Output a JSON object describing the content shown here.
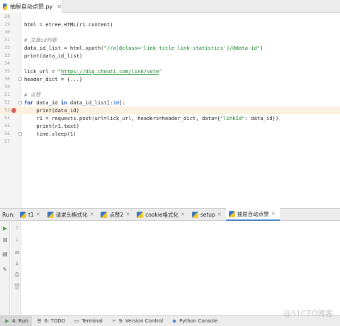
{
  "editor": {
    "active_tab": "抽屉自动点赞.py",
    "lines": [
      {
        "n": "28",
        "code": ""
      },
      {
        "n": "29",
        "code": "html = etree.HTML(r1.content)"
      },
      {
        "n": "30",
        "code": ""
      },
      {
        "n": "31",
        "code": "# 文章id列表"
      },
      {
        "n": "32",
        "code": "data_id_list = html.xpath(\"//a[@class='link-title link-statistics']/@data-id\")"
      },
      {
        "n": "33",
        "code": "print(data_id_list)"
      },
      {
        "n": "34",
        "code": ""
      },
      {
        "n": "35",
        "code": "lick_url = \"https://dig.chouti.com/link/vote\""
      },
      {
        "n": "36",
        "code": "header_dict = {...}"
      },
      {
        "n": "50",
        "code": ""
      },
      {
        "n": "51",
        "code": "# 点赞"
      },
      {
        "n": "52",
        "code": "for data_id in data_id_list[:10]:"
      },
      {
        "n": "53",
        "code": "    print(data_id)"
      },
      {
        "n": "54",
        "code": "    r1 = requests.post(url=lick_url, headers=header_dict, data={\"linkId\": data_id})"
      },
      {
        "n": "55",
        "code": "    print(r1.text)"
      },
      {
        "n": "56",
        "code": "    time.sleep(1)"
      },
      {
        "n": "57",
        "code": ""
      }
    ]
  },
  "run": {
    "label": "Run:",
    "tabs": [
      "t1",
      "请求头格式化",
      "点赞2",
      "cookie格式化",
      "setup",
      "抽屉自动点赞"
    ],
    "active_tab_index": 5
  },
  "status_bar": {
    "items": [
      "4: Run",
      "6: TODO",
      "Terminal",
      "9: Version Control",
      "Python Console"
    ]
  },
  "watermark": "@51CTO博客",
  "icons": {
    "run_tab": "python-file-icon",
    "rerun": "play-icon",
    "stop": "stop-icon"
  },
  "colors": {
    "keyword": "#0033b3",
    "string": "#067d17",
    "comment": "#8c8c8c",
    "breakpoint": "#db5c5c",
    "active_tab_underline": "#4a86c8"
  }
}
